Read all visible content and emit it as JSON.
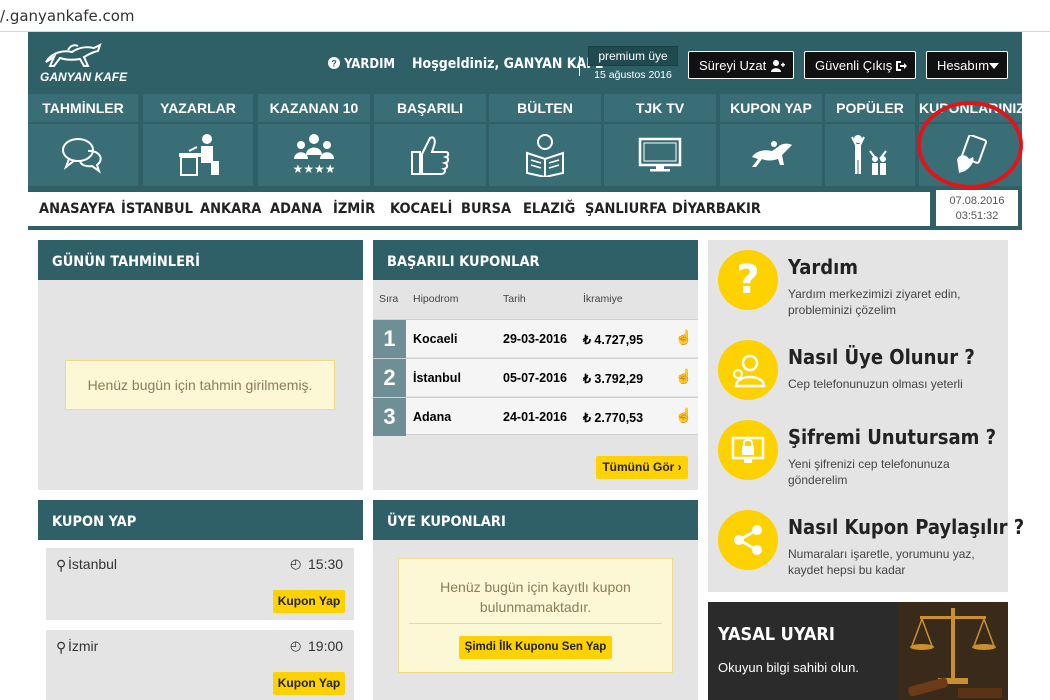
{
  "browser": {
    "url": "/.ganyankafe.com"
  },
  "header": {
    "logo_text": "GANYAN KAFE",
    "help_label": "YARDIM",
    "welcome": "Hoşgeldiniz, GANYAN KAFE",
    "premium_label": "premium üye",
    "premium_date": "15 ağustos 2016",
    "extend_label": "Süreyi Uzat",
    "logout_label": "Güvenli Çıkış",
    "account_label": "Hesabım"
  },
  "nav": [
    {
      "label": "TAHMİNLER",
      "icon": "chat-bubbles-icon"
    },
    {
      "label": "YAZARLAR",
      "icon": "writer-desk-icon"
    },
    {
      "label": "KAZANAN 10",
      "icon": "winners-group-icon"
    },
    {
      "label": "BAŞARILI",
      "icon": "thumbs-up-icon"
    },
    {
      "label": "BÜLTEN",
      "icon": "reader-icon"
    },
    {
      "label": "TJK TV",
      "icon": "tv-icon"
    },
    {
      "label": "KUPON YAP",
      "icon": "racehorse-icon"
    },
    {
      "label": "POPÜLER",
      "icon": "popular-people-icon"
    },
    {
      "label": "KUPONLARINIZ",
      "icon": "coupon-hand-icon"
    }
  ],
  "cities": [
    "ANASAYFA",
    "İSTANBUL",
    "ANKARA",
    "ADANA",
    "İZMİR",
    "KOCAELİ",
    "BURSA",
    "ELAZIĞ",
    "ŞANLIURFA",
    "DİYARBAKIR"
  ],
  "clock": {
    "date": "07.08.2016",
    "time": "03:51:32"
  },
  "gunun": {
    "title": "GÜNÜN TAHMİNLERİ",
    "empty": "Henüz bugün için tahmin girilmemiş."
  },
  "basarili": {
    "title": "BAŞARILI KUPONLAR",
    "headers": [
      "Sıra",
      "Hipodrom",
      "Tarih",
      "İkramiye"
    ],
    "rows": [
      {
        "rank": "1",
        "place": "Kocaeli",
        "date": "29-03-2016",
        "prize": "₺ 4.727,95"
      },
      {
        "rank": "2",
        "place": "İstanbul",
        "date": "05-07-2016",
        "prize": "₺ 3.792,29"
      },
      {
        "rank": "3",
        "place": "Adana",
        "date": "24-01-2016",
        "prize": "₺ 2.770,53"
      }
    ],
    "see_all": "Tümünü Gör"
  },
  "kupon_yap": {
    "title": "KUPON YAP",
    "items": [
      {
        "city": "İstanbul",
        "time": "15:30",
        "button": "Kupon Yap"
      },
      {
        "city": "İzmir",
        "time": "19:00",
        "button": "Kupon Yap"
      }
    ]
  },
  "uye": {
    "title": "ÜYE KUPONLARI",
    "empty_line1": "Henüz bugün için kayıtlı kupon",
    "empty_line2": "bulunmamaktadır.",
    "button": "Şimdi İlk Kuponu Sen Yap"
  },
  "help": [
    {
      "title": "Yardım",
      "desc": "Yardım merkezimizi ziyaret edin, probleminizi çözelim",
      "icon": "question-mark-icon"
    },
    {
      "title": "Nasıl Üye Olunur ?",
      "desc": "Cep telefonunuzun olması yeterli",
      "icon": "user-icon"
    },
    {
      "title": "Şifremi Unutursam ?",
      "desc": "Yeni şifrenizi cep telefonunuza gönderelim",
      "icon": "lock-monitor-icon"
    },
    {
      "title": "Nasıl Kupon Paylaşılır ?",
      "desc": "Numaraları işaretle, yorumunu yaz, kaydet hepsi bu kadar",
      "icon": "share-icon"
    }
  ],
  "legal": {
    "title": "YASAL UYARI",
    "text": "Okuyun bilgi sahibi olun."
  },
  "colors": {
    "teal": "#2f6068",
    "tab": "#3a6e76",
    "yellow": "#fdd200",
    "highlight": "#e0151a"
  }
}
